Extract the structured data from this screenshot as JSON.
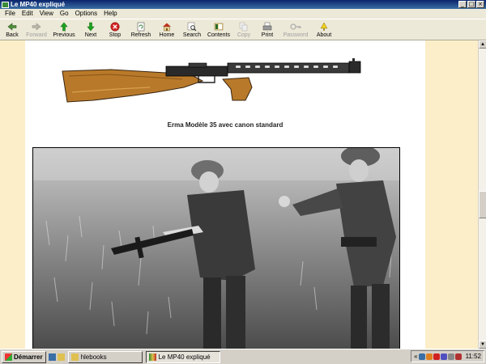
{
  "window": {
    "title": "Le MP40 expliqué"
  },
  "menu": [
    "File",
    "Edit",
    "View",
    "Go",
    "Options",
    "Help"
  ],
  "toolbar": [
    {
      "label": "Back",
      "icon": "back-arrow-icon",
      "enabled": true
    },
    {
      "label": "Forward",
      "icon": "forward-arrow-icon",
      "enabled": false
    },
    {
      "label": "Previous",
      "icon": "previous-arrow-icon",
      "enabled": true
    },
    {
      "label": "Next",
      "icon": "next-arrow-icon",
      "enabled": true
    },
    {
      "label": "Stop",
      "icon": "stop-icon",
      "enabled": true
    },
    {
      "label": "Refresh",
      "icon": "refresh-icon",
      "enabled": true
    },
    {
      "label": "Home",
      "icon": "home-icon",
      "enabled": true
    },
    {
      "label": "Search",
      "icon": "search-icon",
      "enabled": true
    },
    {
      "label": "Contents",
      "icon": "contents-icon",
      "enabled": true
    },
    {
      "label": "Copy",
      "icon": "copy-icon",
      "enabled": false
    },
    {
      "label": "Print",
      "icon": "print-icon",
      "enabled": true
    },
    {
      "label": "Password",
      "icon": "key-icon",
      "enabled": false
    },
    {
      "label": "About",
      "icon": "about-icon",
      "enabled": true
    }
  ],
  "content": {
    "caption": "Erma Modèle 35 avec canon standard"
  },
  "taskbar": {
    "start_label": "Démarrer",
    "tasks": [
      {
        "label": "hlebooks",
        "active": false
      },
      {
        "label": "Le MP40 expliqué",
        "active": true
      }
    ],
    "clock": "11:52"
  },
  "colors": {
    "page_background": "#fbeec9",
    "titlebar": "#0a246a",
    "chrome": "#ece9d8"
  }
}
